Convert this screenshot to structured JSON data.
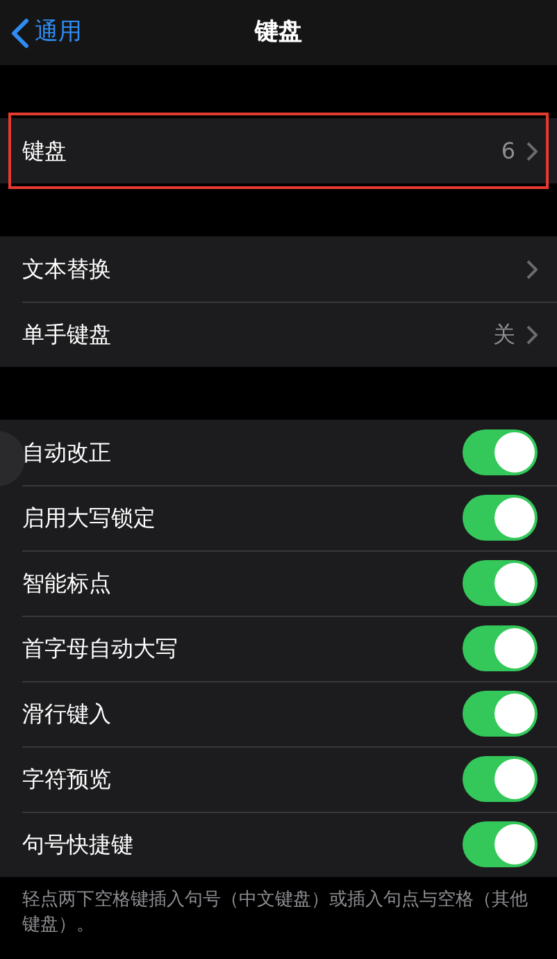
{
  "nav": {
    "back": "通用",
    "title": "键盘"
  },
  "groups": [
    {
      "rows": [
        {
          "kind": "link",
          "label": "键盘",
          "value": "6",
          "highlighted": true
        }
      ]
    },
    {
      "rows": [
        {
          "kind": "link",
          "label": "文本替换",
          "highlighted": false
        },
        {
          "kind": "link",
          "label": "单手键盘",
          "value": "关",
          "highlighted": false
        }
      ]
    },
    {
      "rows": [
        {
          "kind": "toggle",
          "label": "自动改正",
          "on": true
        },
        {
          "kind": "toggle",
          "label": "启用大写锁定",
          "on": true
        },
        {
          "kind": "toggle",
          "label": "智能标点",
          "on": true
        },
        {
          "kind": "toggle",
          "label": "首字母自动大写",
          "on": true
        },
        {
          "kind": "toggle",
          "label": "滑行键入",
          "on": true
        },
        {
          "kind": "toggle",
          "label": "字符预览",
          "on": true
        },
        {
          "kind": "toggle",
          "label": "句号快捷键",
          "on": true
        }
      ],
      "footer": "轻点两下空格键插入句号（中文键盘）或插入句点与空格（其他键盘）。"
    }
  ]
}
